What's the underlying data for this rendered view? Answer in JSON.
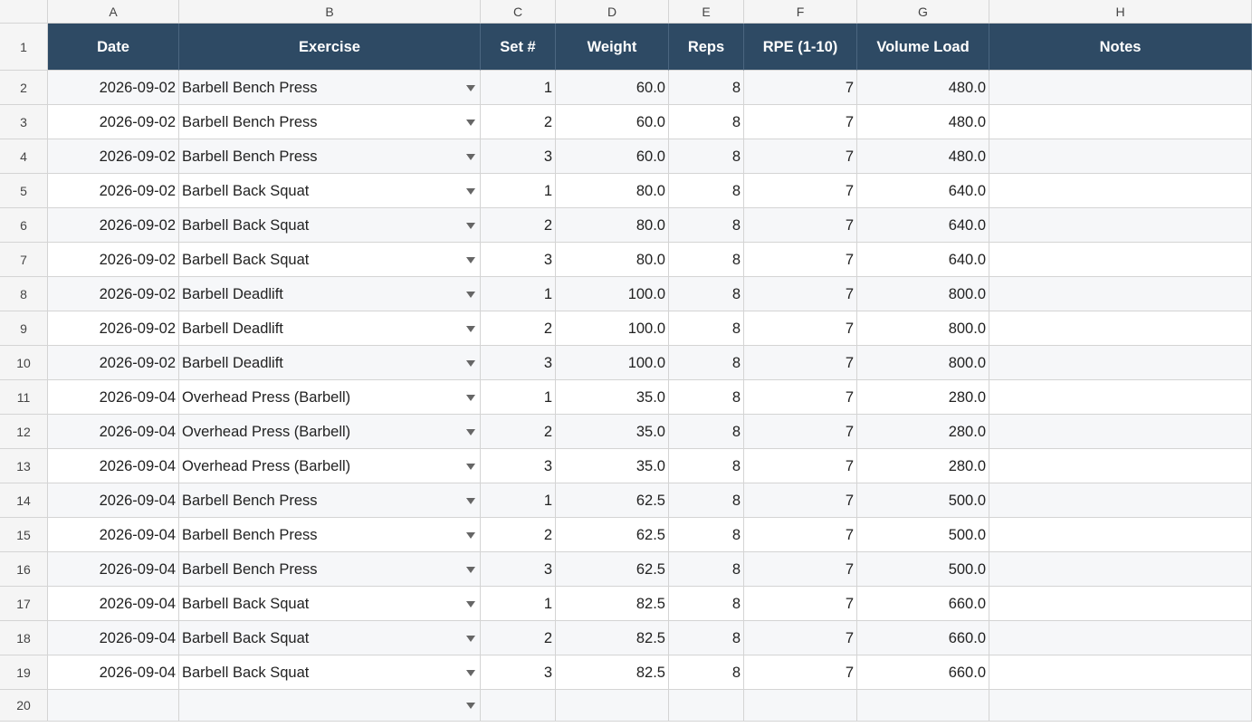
{
  "column_letters": [
    "A",
    "B",
    "C",
    "D",
    "E",
    "F",
    "G",
    "H"
  ],
  "headers": [
    "Date",
    "Exercise",
    "Set #",
    "Weight",
    "Reps",
    "RPE (1-10)",
    "Volume Load",
    "Notes"
  ],
  "row_numbers": [
    "1",
    "2",
    "3",
    "4",
    "5",
    "6",
    "7",
    "8",
    "9",
    "10",
    "11",
    "12",
    "13",
    "14",
    "15",
    "16",
    "17",
    "18",
    "19",
    "20"
  ],
  "rows": [
    {
      "date": "2026-09-02",
      "exercise": "Barbell Bench Press",
      "set": "1",
      "weight": "60.0",
      "reps": "8",
      "rpe": "7",
      "volume": "480.0",
      "notes": ""
    },
    {
      "date": "2026-09-02",
      "exercise": "Barbell Bench Press",
      "set": "2",
      "weight": "60.0",
      "reps": "8",
      "rpe": "7",
      "volume": "480.0",
      "notes": ""
    },
    {
      "date": "2026-09-02",
      "exercise": "Barbell Bench Press",
      "set": "3",
      "weight": "60.0",
      "reps": "8",
      "rpe": "7",
      "volume": "480.0",
      "notes": ""
    },
    {
      "date": "2026-09-02",
      "exercise": "Barbell Back Squat",
      "set": "1",
      "weight": "80.0",
      "reps": "8",
      "rpe": "7",
      "volume": "640.0",
      "notes": ""
    },
    {
      "date": "2026-09-02",
      "exercise": "Barbell Back Squat",
      "set": "2",
      "weight": "80.0",
      "reps": "8",
      "rpe": "7",
      "volume": "640.0",
      "notes": ""
    },
    {
      "date": "2026-09-02",
      "exercise": "Barbell Back Squat",
      "set": "3",
      "weight": "80.0",
      "reps": "8",
      "rpe": "7",
      "volume": "640.0",
      "notes": ""
    },
    {
      "date": "2026-09-02",
      "exercise": "Barbell Deadlift",
      "set": "1",
      "weight": "100.0",
      "reps": "8",
      "rpe": "7",
      "volume": "800.0",
      "notes": ""
    },
    {
      "date": "2026-09-02",
      "exercise": "Barbell Deadlift",
      "set": "2",
      "weight": "100.0",
      "reps": "8",
      "rpe": "7",
      "volume": "800.0",
      "notes": ""
    },
    {
      "date": "2026-09-02",
      "exercise": "Barbell Deadlift",
      "set": "3",
      "weight": "100.0",
      "reps": "8",
      "rpe": "7",
      "volume": "800.0",
      "notes": ""
    },
    {
      "date": "2026-09-04",
      "exercise": "Overhead Press (Barbell)",
      "set": "1",
      "weight": "35.0",
      "reps": "8",
      "rpe": "7",
      "volume": "280.0",
      "notes": ""
    },
    {
      "date": "2026-09-04",
      "exercise": "Overhead Press (Barbell)",
      "set": "2",
      "weight": "35.0",
      "reps": "8",
      "rpe": "7",
      "volume": "280.0",
      "notes": ""
    },
    {
      "date": "2026-09-04",
      "exercise": "Overhead Press (Barbell)",
      "set": "3",
      "weight": "35.0",
      "reps": "8",
      "rpe": "7",
      "volume": "280.0",
      "notes": ""
    },
    {
      "date": "2026-09-04",
      "exercise": "Barbell Bench Press",
      "set": "1",
      "weight": "62.5",
      "reps": "8",
      "rpe": "7",
      "volume": "500.0",
      "notes": ""
    },
    {
      "date": "2026-09-04",
      "exercise": "Barbell Bench Press",
      "set": "2",
      "weight": "62.5",
      "reps": "8",
      "rpe": "7",
      "volume": "500.0",
      "notes": ""
    },
    {
      "date": "2026-09-04",
      "exercise": "Barbell Bench Press",
      "set": "3",
      "weight": "62.5",
      "reps": "8",
      "rpe": "7",
      "volume": "500.0",
      "notes": ""
    },
    {
      "date": "2026-09-04",
      "exercise": "Barbell Back Squat",
      "set": "1",
      "weight": "82.5",
      "reps": "8",
      "rpe": "7",
      "volume": "660.0",
      "notes": ""
    },
    {
      "date": "2026-09-04",
      "exercise": "Barbell Back Squat",
      "set": "2",
      "weight": "82.5",
      "reps": "8",
      "rpe": "7",
      "volume": "660.0",
      "notes": ""
    },
    {
      "date": "2026-09-04",
      "exercise": "Barbell Back Squat",
      "set": "3",
      "weight": "82.5",
      "reps": "8",
      "rpe": "7",
      "volume": "660.0",
      "notes": ""
    },
    {
      "date": "",
      "exercise": "",
      "set": "",
      "weight": "",
      "reps": "",
      "rpe": "",
      "volume": "",
      "notes": ""
    }
  ],
  "colors": {
    "header_fill": "#2e4a64",
    "header_text": "#ffffff",
    "band_fill": "#f6f7f9",
    "gridline": "#d4d4d4"
  },
  "icons": {
    "dropdown": "chevron-down-icon"
  }
}
